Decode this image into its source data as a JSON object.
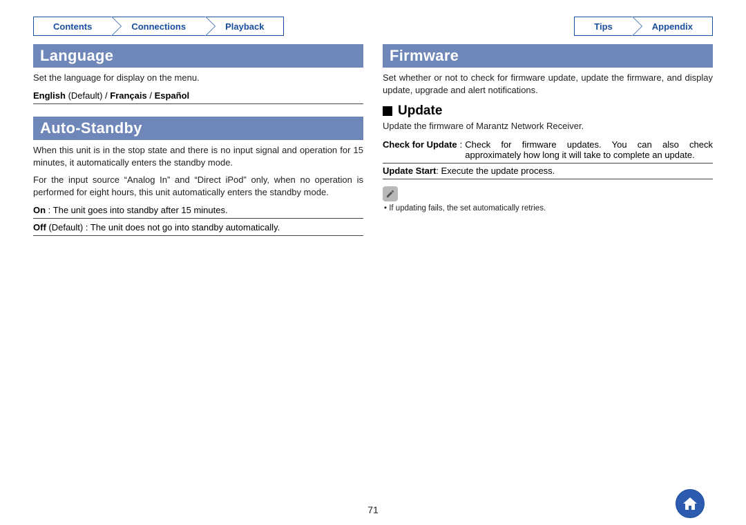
{
  "tabs": {
    "left": [
      "Contents",
      "Connections",
      "Playback"
    ],
    "right": [
      "Tips",
      "Appendix"
    ]
  },
  "left_col": {
    "language": {
      "header": "Language",
      "desc": "Set the language for display on the menu.",
      "options_bold1": "English",
      "options_plain1": " (Default) / ",
      "options_bold2": "Français",
      "options_plain2": " / ",
      "options_bold3": "Español"
    },
    "auto_standby": {
      "header": "Auto-Standby",
      "p1": "When this unit is in the stop state and there is no input signal and operation for 15 minutes, it automatically enters the standby mode.",
      "p2": "For the input source “Analog In” and “Direct iPod” only, when no operation is performed for eight hours, this unit automatically enters the standby mode.",
      "on_label": "On",
      "on_desc": " : The unit goes into standby after 15 minutes.",
      "off_label": "Off",
      "off_desc": " (Default) : The unit does not go into standby automatically."
    }
  },
  "right_col": {
    "firmware": {
      "header": "Firmware",
      "desc": "Set whether or not to check for firmware update, update the firmware, and display update, upgrade and alert notifications.",
      "update_sub": "Update",
      "update_desc": "Update the firmware of Marantz Network Receiver.",
      "check_label": "Check for Update",
      "check_desc": "Check for firmware updates. You can also check approximately how long it will take to complete an update.",
      "start_label": "Update Start",
      "start_desc": " : Execute the update process.",
      "note_bullet": "• If updating fails, the set automatically retries."
    }
  },
  "page_number": "71"
}
